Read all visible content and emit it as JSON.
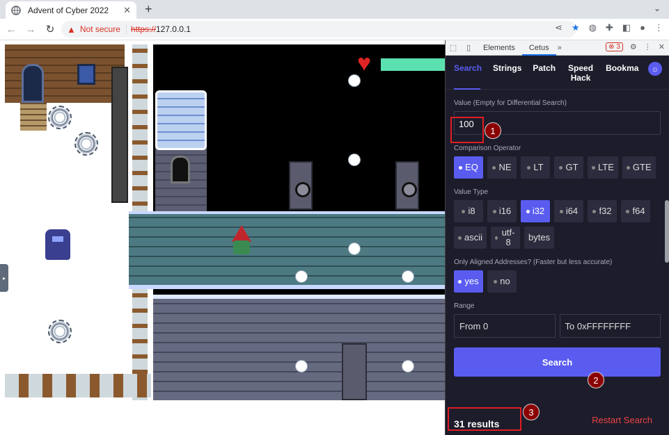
{
  "browser": {
    "tab_title": "Advent of Cyber 2022",
    "tab_close": "✕",
    "new_tab": "+",
    "not_secure": "Not secure",
    "url_scheme": "https://",
    "url_host": "127.0.0.1"
  },
  "devtools": {
    "tab_elements": "Elements",
    "tab_cetus": "Cetus",
    "more": "»",
    "error_count": "3"
  },
  "cetus": {
    "nav": [
      "Search",
      "Strings",
      "Patch",
      "Speed Hack",
      "Bookma"
    ],
    "value_label": "Value (Empty for Differential Search)",
    "value": "100",
    "comparison_label": "Comparison Operator",
    "operators": [
      "EQ",
      "NE",
      "LT",
      "GT",
      "LTE",
      "GTE"
    ],
    "value_type_label": "Value Type",
    "value_types": [
      "i8",
      "i16",
      "i32",
      "i64",
      "f32",
      "f64",
      "ascii",
      "utf-8",
      "bytes"
    ],
    "aligned_label": "Only Aligned Addresses? (Faster but less accurate)",
    "aligned_options": [
      "yes",
      "no"
    ],
    "range_label": "Range",
    "range_from": "From 0",
    "range_to": "To 0xFFFFFFFF",
    "search_button": "Search",
    "results": "31 results",
    "restart": "Restart Search"
  },
  "annotations": [
    "1",
    "2",
    "3"
  ],
  "colors": {
    "accent": "#5a5cf0",
    "panel": "#1c1c2b",
    "callout": "#e11d22"
  }
}
